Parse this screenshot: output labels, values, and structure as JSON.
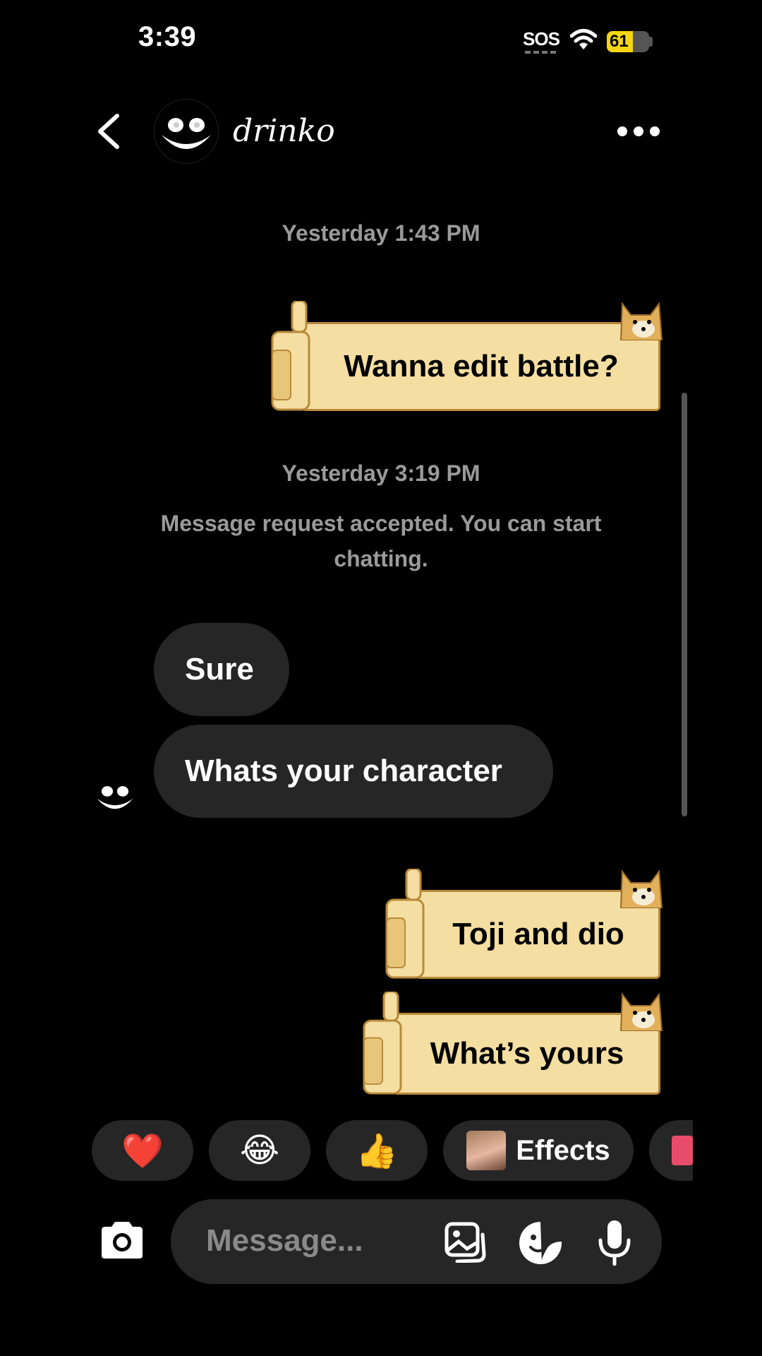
{
  "status_bar": {
    "time": "3:39",
    "sos": "SOS",
    "battery_percent": "61",
    "battery_level": 0.61
  },
  "header": {
    "username": "drinko"
  },
  "chat": {
    "stamp1": "Yesterday 1:43 PM",
    "msg1": "Wanna edit battle?",
    "stamp2": "Yesterday 3:19 PM",
    "system_note": "Message request accepted. You can start chatting.",
    "reply1": "Sure",
    "reply2": "Whats your character",
    "msg2": "Toji and dio",
    "msg3": "What’s yours"
  },
  "reactions": {
    "heart": "❤️",
    "laugh": "😂",
    "thumbs_up": "👍",
    "effects_label": "Effects"
  },
  "composer": {
    "placeholder": "Message..."
  },
  "colors": {
    "bubble": "#262626",
    "scroll": "#f4dea2",
    "accent_battery": "#f5d515"
  },
  "icons": [
    "back-chevron-icon",
    "more-icon",
    "camera-icon",
    "gallery-icon",
    "sticker-icon",
    "mic-icon",
    "wifi-icon",
    "battery-icon"
  ]
}
